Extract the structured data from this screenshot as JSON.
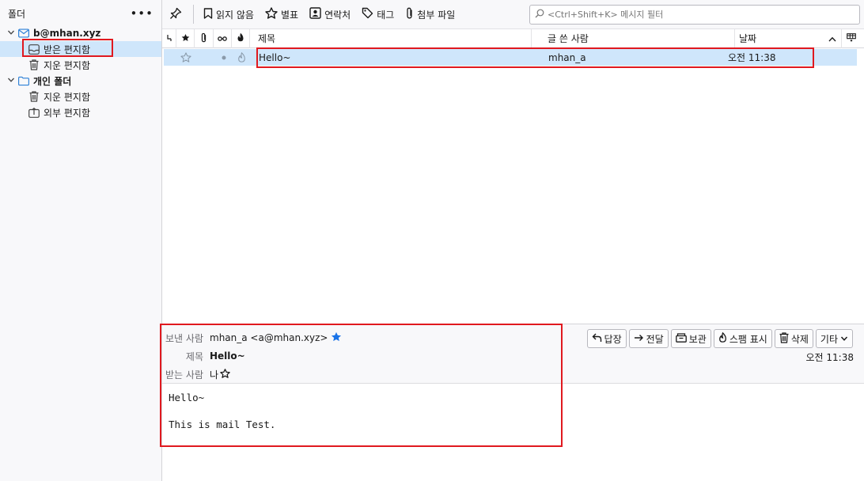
{
  "folder_pane": {
    "title": "폴더",
    "more": "•••",
    "account": "b@mhan.xyz",
    "account_folders": [
      {
        "label": "받은 편지함",
        "icon": "inbox-icon"
      },
      {
        "label": "지운 편지함",
        "icon": "trash-icon"
      }
    ],
    "local_title": "개인 폴더",
    "local_folders": [
      {
        "label": "지운 편지함",
        "icon": "trash-icon"
      },
      {
        "label": "외부 편지함",
        "icon": "outbox-icon"
      }
    ]
  },
  "toolbar": {
    "unread_label": "읽지 않음",
    "starred_label": "별표",
    "contacts_label": "연락처",
    "tags_label": "태그",
    "attachment_label": "첨부 파일",
    "search_placeholder": "<Ctrl+Shift+K> 메시지 필터"
  },
  "message_list": {
    "columns": {
      "subject": "제목",
      "sender": "글 쓴 사람",
      "date": "날짜"
    },
    "rows": [
      {
        "subject": "Hello~",
        "sender": "mhan_a",
        "date": "오전 11:38"
      }
    ]
  },
  "reader": {
    "from_label": "보낸 사람",
    "from_value": "mhan_a <a@mhan.xyz>",
    "subject_label": "제목",
    "subject_value": "Hello~",
    "to_label": "받는 사람",
    "to_value": "나",
    "date": "오전 11:38",
    "actions": {
      "reply": "답장",
      "forward": "전달",
      "archive": "보관",
      "junk": "스팸 표시",
      "delete": "삭제",
      "more": "기타"
    },
    "body_lines": [
      "Hello~",
      "",
      "This is mail Test."
    ]
  },
  "colors": {
    "selection": "#cfe6fb",
    "highlight_box": "#e0191f",
    "star_blue": "#1a73e8"
  }
}
